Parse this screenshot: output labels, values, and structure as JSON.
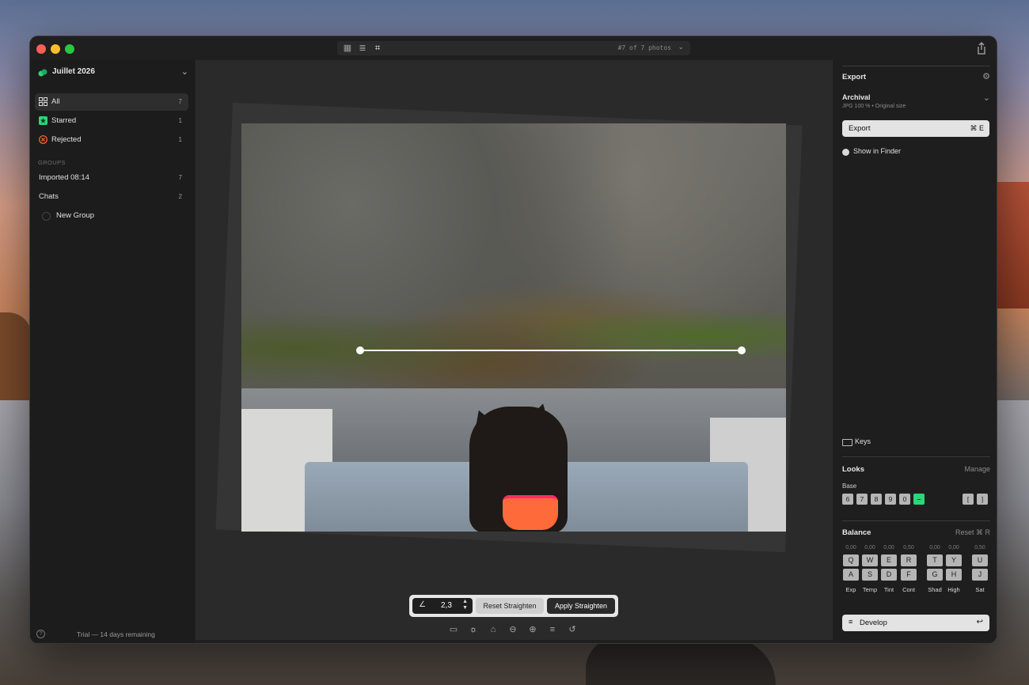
{
  "window": {
    "library": "Juillet 2026"
  },
  "titlebar": {
    "photo_counter": "#7 of 7 photos",
    "icons": [
      "grid-icon",
      "adjust-icon",
      "crop-icon",
      "share-icon"
    ]
  },
  "sidebar": {
    "items": [
      {
        "label": "All",
        "count": "7",
        "icon": "grid-icon"
      },
      {
        "label": "Starred",
        "count": "1",
        "icon": "star-icon"
      },
      {
        "label": "Rejected",
        "count": "1",
        "icon": "reject-icon"
      }
    ],
    "groups_header": "GROUPS",
    "groups": [
      {
        "label": "Imported 08:14",
        "count": "7"
      },
      {
        "label": "Chats",
        "count": "2"
      },
      {
        "label": "New Group",
        "count": ""
      }
    ],
    "footer": "Trial — 14 days remaining"
  },
  "editor": {
    "angle_value": "2,3",
    "reset_straighten": "Reset Straighten",
    "apply_straighten": "Apply Straighten",
    "tools": [
      "crop-tool-icon",
      "straighten-tool-icon",
      "perspective-v-icon",
      "perspective-h-icon",
      "grid-tool-icon",
      "adjust-tool-icon",
      "rotate-icon"
    ]
  },
  "right_panel": {
    "export_title": "Export",
    "preset_title": "Archival",
    "preset_sub": "JPG 100 % • Original size",
    "export_button": "Export",
    "export_shortcut": "⌘ E",
    "show_in_finder": "Show in Finder",
    "keys": "Keys",
    "looks_title": "Looks",
    "manage": "Manage",
    "base": "Base",
    "look_keys": [
      "6",
      "7",
      "8",
      "9",
      "0",
      "–"
    ],
    "bracket_keys": [
      "[",
      "]"
    ],
    "balance_title": "Balance",
    "balance_reset": "Reset ⌘ R",
    "balance_values": [
      "0,00",
      "0,00",
      "0,00",
      "0,50",
      "0,00",
      "0,00",
      "0,50"
    ],
    "balance_top_keys": [
      "Q",
      "W",
      "E",
      "R",
      "T",
      "Y",
      "U"
    ],
    "balance_bottom_keys": [
      "A",
      "S",
      "D",
      "F",
      "G",
      "H",
      "J"
    ],
    "balance_labels": [
      "Exp",
      "Temp",
      "Tint",
      "Cont",
      "Shad",
      "High",
      "Sat"
    ],
    "develop": "Develop",
    "develop_shortcut": "↩"
  },
  "colors": {
    "accent": "#2ed47a",
    "window_bg": "#1f1f1f",
    "canvas_bg": "#2a2a2a"
  }
}
